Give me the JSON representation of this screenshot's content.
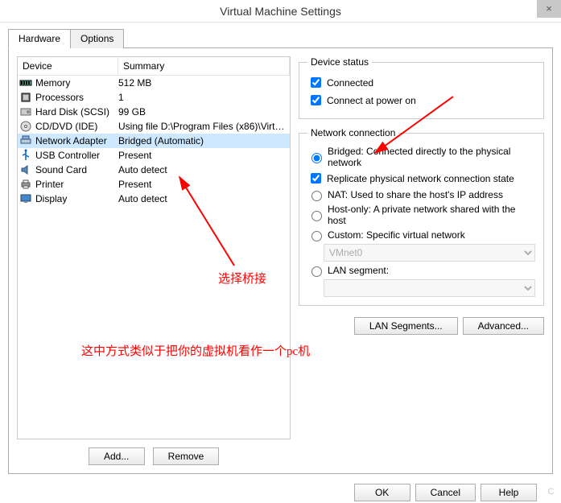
{
  "window": {
    "title": "Virtual Machine Settings",
    "close_glyph": "×"
  },
  "tabs": {
    "hardware": "Hardware",
    "options": "Options"
  },
  "device_table": {
    "header_device": "Device",
    "header_summary": "Summary",
    "rows": [
      {
        "name": "Memory",
        "summary": "512 MB",
        "icon": "memory"
      },
      {
        "name": "Processors",
        "summary": "1",
        "icon": "cpu"
      },
      {
        "name": "Hard Disk (SCSI)",
        "summary": "99 GB",
        "icon": "disk"
      },
      {
        "name": "CD/DVD (IDE)",
        "summary": "Using file D:\\Program Files (x86)\\Virtua...",
        "icon": "cd"
      },
      {
        "name": "Network Adapter",
        "summary": "Bridged (Automatic)",
        "icon": "net",
        "selected": true
      },
      {
        "name": "USB Controller",
        "summary": "Present",
        "icon": "usb"
      },
      {
        "name": "Sound Card",
        "summary": "Auto detect",
        "icon": "sound"
      },
      {
        "name": "Printer",
        "summary": "Present",
        "icon": "printer"
      },
      {
        "name": "Display",
        "summary": "Auto detect",
        "icon": "display"
      }
    ],
    "add_label": "Add...",
    "remove_label": "Remove"
  },
  "device_status": {
    "legend": "Device status",
    "connected": "Connected",
    "connect_power": "Connect at power on"
  },
  "network_connection": {
    "legend": "Network connection",
    "bridged": "Bridged: Connected directly to the physical network",
    "replicate": "Replicate physical network connection state",
    "nat": "NAT: Used to share the host's IP address",
    "hostonly": "Host-only: A private network shared with the host",
    "custom": "Custom: Specific virtual network",
    "custom_value": "VMnet0",
    "lan": "LAN segment:",
    "lan_value": "",
    "lan_segments_btn": "LAN Segments...",
    "advanced_btn": "Advanced..."
  },
  "dialog_buttons": {
    "ok": "OK",
    "cancel": "Cancel",
    "help": "Help"
  },
  "annotations": {
    "label1": "选择桥接",
    "label2": "这中方式类似于把你的虚拟机看作一个pc机"
  },
  "watermark": "C"
}
